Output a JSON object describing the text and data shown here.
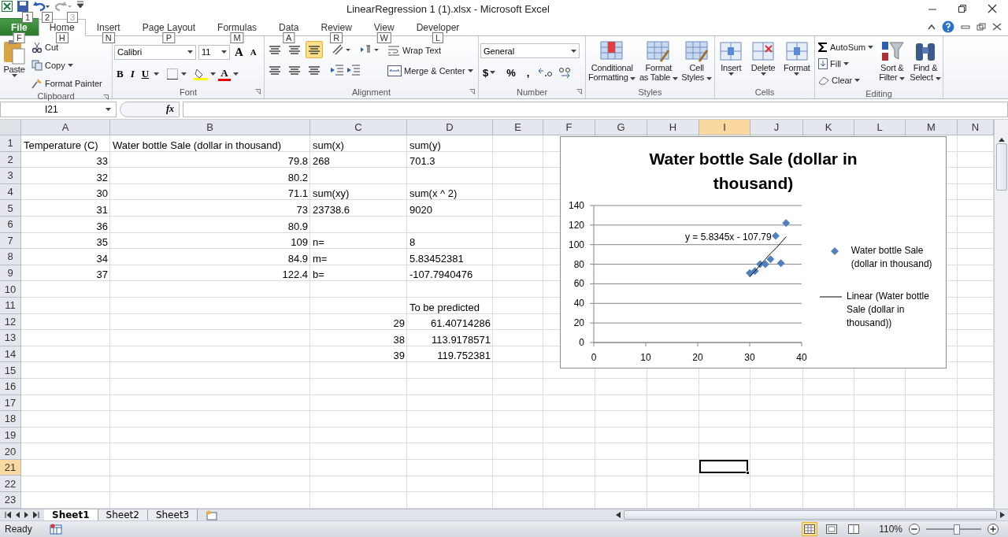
{
  "window": {
    "title": "LinearRegression 1 (1).xlsx  -  Microsoft Excel"
  },
  "quick_access_keytips": [
    {
      "label": "1",
      "disabled": false
    },
    {
      "label": "2",
      "disabled": false
    },
    {
      "label": "3",
      "disabled": true
    }
  ],
  "tabs": [
    {
      "label": "File",
      "keytip": "F",
      "kind": "file",
      "selected": false
    },
    {
      "label": "Home",
      "keytip": "H",
      "kind": "tab",
      "selected": true
    },
    {
      "label": "Insert",
      "keytip": "N",
      "kind": "tab",
      "selected": false
    },
    {
      "label": "Page Layout",
      "keytip": "P",
      "kind": "tab",
      "selected": false
    },
    {
      "label": "Formulas",
      "keytip": "M",
      "kind": "tab",
      "selected": false
    },
    {
      "label": "Data",
      "keytip": "A",
      "kind": "tab",
      "selected": false
    },
    {
      "label": "Review",
      "keytip": "R",
      "kind": "tab",
      "selected": false
    },
    {
      "label": "View",
      "keytip": "W",
      "kind": "tab",
      "selected": false
    },
    {
      "label": "Developer",
      "keytip": "L",
      "kind": "tab",
      "selected": false
    }
  ],
  "ribbon": {
    "clipboard": {
      "label": "Clipboard",
      "paste": "Paste",
      "cut": "Cut",
      "copy": "Copy",
      "format_painter": "Format Painter"
    },
    "font": {
      "label": "Font",
      "font_name": "Calibri",
      "font_size": "11",
      "grow": "A",
      "shrink": "A",
      "bold": "B",
      "italic": "I",
      "underline": "U",
      "font_color": "A"
    },
    "alignment": {
      "label": "Alignment",
      "vertical_align": [
        {
          "selected": false
        },
        {
          "selected": false
        },
        {
          "selected": true
        }
      ],
      "wrap_text": "Wrap Text",
      "merge_center": "Merge & Center"
    },
    "number": {
      "label": "Number",
      "format": "General",
      "currency": "$",
      "percent": "%",
      "comma": ","
    },
    "styles": {
      "label": "Styles",
      "buttons": [
        {
          "lines": [
            "Conditional",
            "Formatting"
          ]
        },
        {
          "lines": [
            "Format",
            "as Table"
          ]
        },
        {
          "lines": [
            "Cell",
            "Styles"
          ]
        }
      ]
    },
    "cells": {
      "label": "Cells",
      "buttons": [
        "Insert",
        "Delete",
        "Format"
      ]
    },
    "editing": {
      "label": "Editing",
      "autosum": "AutoSum",
      "fill": "Fill",
      "clear": "Clear",
      "sort_filter": [
        "Sort &",
        "Filter"
      ],
      "find_select": [
        "Find &",
        "Select"
      ]
    }
  },
  "formula_bar": {
    "name_box": "I21",
    "function_label": "fx"
  },
  "sheet": {
    "columns": [
      {
        "label": "A",
        "selected": false
      },
      {
        "label": "B",
        "selected": false
      },
      {
        "label": "C",
        "selected": false
      },
      {
        "label": "D",
        "selected": false
      },
      {
        "label": "E",
        "selected": false
      },
      {
        "label": "F",
        "selected": false
      },
      {
        "label": "G",
        "selected": false
      },
      {
        "label": "H",
        "selected": false
      },
      {
        "label": "I",
        "selected": true
      },
      {
        "label": "J",
        "selected": false
      },
      {
        "label": "K",
        "selected": false
      },
      {
        "label": "L",
        "selected": false
      },
      {
        "label": "M",
        "selected": false
      },
      {
        "label": "N",
        "selected": false
      }
    ],
    "rows": [
      {
        "number": "1",
        "selected": false,
        "cells": [
          {
            "text": "Temperature (C)",
            "kind": "text"
          },
          {
            "text": "Water bottle Sale (dollar in thousand)",
            "kind": "text"
          },
          {
            "text": "sum(x)",
            "kind": "text"
          },
          {
            "text": "sum(y)",
            "kind": "text"
          }
        ]
      },
      {
        "number": "2",
        "selected": false,
        "cells": [
          {
            "text": "33",
            "kind": "number"
          },
          {
            "text": "79.8",
            "kind": "number"
          },
          {
            "text": "268",
            "kind": "text"
          },
          {
            "text": "701.3",
            "kind": "text"
          }
        ]
      },
      {
        "number": "3",
        "selected": false,
        "cells": [
          {
            "text": "32",
            "kind": "number"
          },
          {
            "text": "80.2",
            "kind": "number"
          }
        ]
      },
      {
        "number": "4",
        "selected": false,
        "cells": [
          {
            "text": "30",
            "kind": "number"
          },
          {
            "text": "71.1",
            "kind": "number"
          },
          {
            "text": "sum(xy)",
            "kind": "text"
          },
          {
            "text": "sum(x ^ 2)",
            "kind": "text"
          }
        ]
      },
      {
        "number": "5",
        "selected": false,
        "cells": [
          {
            "text": "31",
            "kind": "number"
          },
          {
            "text": "73",
            "kind": "number"
          },
          {
            "text": "23738.6",
            "kind": "text"
          },
          {
            "text": "9020",
            "kind": "text"
          }
        ]
      },
      {
        "number": "6",
        "selected": false,
        "cells": [
          {
            "text": "36",
            "kind": "number"
          },
          {
            "text": "80.9",
            "kind": "number"
          }
        ]
      },
      {
        "number": "7",
        "selected": false,
        "cells": [
          {
            "text": "35",
            "kind": "number"
          },
          {
            "text": "109",
            "kind": "number"
          },
          {
            "text": "n=",
            "kind": "text"
          },
          {
            "text": "8",
            "kind": "text"
          }
        ]
      },
      {
        "number": "8",
        "selected": false,
        "cells": [
          {
            "text": "34",
            "kind": "number"
          },
          {
            "text": "84.9",
            "kind": "number"
          },
          {
            "text": "m=",
            "kind": "text"
          },
          {
            "text": "5.83452381",
            "kind": "text"
          }
        ]
      },
      {
        "number": "9",
        "selected": false,
        "cells": [
          {
            "text": "37",
            "kind": "number"
          },
          {
            "text": "122.4",
            "kind": "number"
          },
          {
            "text": "b=",
            "kind": "text"
          },
          {
            "text": "-107.7940476",
            "kind": "text"
          }
        ]
      },
      {
        "number": "10",
        "selected": false,
        "cells": []
      },
      {
        "number": "11",
        "selected": false,
        "cells": [
          null,
          null,
          null,
          {
            "text": "To be predicted",
            "kind": "text"
          }
        ]
      },
      {
        "number": "12",
        "selected": false,
        "cells": [
          null,
          null,
          {
            "text": "29",
            "kind": "number"
          },
          {
            "text": "61.40714286",
            "kind": "number"
          }
        ]
      },
      {
        "number": "13",
        "selected": false,
        "cells": [
          null,
          null,
          {
            "text": "38",
            "kind": "number"
          },
          {
            "text": "113.9178571",
            "kind": "number"
          }
        ]
      },
      {
        "number": "14",
        "selected": false,
        "cells": [
          null,
          null,
          {
            "text": "39",
            "kind": "number"
          },
          {
            "text": "119.752381",
            "kind": "number"
          }
        ]
      },
      {
        "number": "15",
        "selected": false,
        "cells": []
      },
      {
        "number": "16",
        "selected": false,
        "cells": []
      },
      {
        "number": "17",
        "selected": false,
        "cells": []
      },
      {
        "number": "18",
        "selected": false,
        "cells": []
      },
      {
        "number": "19",
        "selected": false,
        "cells": []
      },
      {
        "number": "20",
        "selected": false,
        "cells": []
      },
      {
        "number": "21",
        "selected": true,
        "cells": [
          null,
          null,
          null,
          null,
          null,
          null,
          null,
          null,
          {
            "selected": true
          }
        ]
      },
      {
        "number": "22",
        "selected": false,
        "cells": []
      },
      {
        "number": "23",
        "selected": false,
        "cells": []
      }
    ],
    "chart": {
      "chart_data": {
        "type": "scatter",
        "title": "Water bottle Sale (dollar in thousand)",
        "x": [
          33,
          32,
          30,
          31,
          36,
          35,
          34,
          37
        ],
        "series": [
          {
            "name": "Water bottle Sale (dollar in thousand)",
            "color": "#4f81bd",
            "values": [
              80,
              80,
              71,
              73,
              81,
              109,
              85,
              122
            ]
          },
          {
            "name": "Linear (Water bottle Sale (dollar in thousand))",
            "type": "line",
            "color": "#000000",
            "values": [
              85,
              79,
              67,
              73,
              102,
              96,
              91,
              108
            ]
          }
        ],
        "xlim": [
          0,
          40
        ],
        "ylim": [
          0,
          140
        ],
        "xticks": [
          0,
          10,
          20,
          30,
          40
        ],
        "yticks": [
          0,
          20,
          40,
          60,
          80,
          100,
          120,
          140
        ],
        "grid": true,
        "legend": "right",
        "annotations": [
          {
            "text": "y = 5.8345x - 107.79",
            "x": 34.2,
            "y": 108
          }
        ]
      }
    }
  },
  "sheet_tabs": [
    {
      "label": "Sheet1",
      "selected": true
    },
    {
      "label": "Sheet2",
      "selected": false
    },
    {
      "label": "Sheet3",
      "selected": false
    }
  ],
  "status_bar": {
    "status": "Ready",
    "view_buttons": [
      {
        "selected": true
      },
      {
        "selected": false
      },
      {
        "selected": false
      }
    ],
    "zoom": "110%",
    "zoom_slider": {
      "level": 0.55
    }
  }
}
